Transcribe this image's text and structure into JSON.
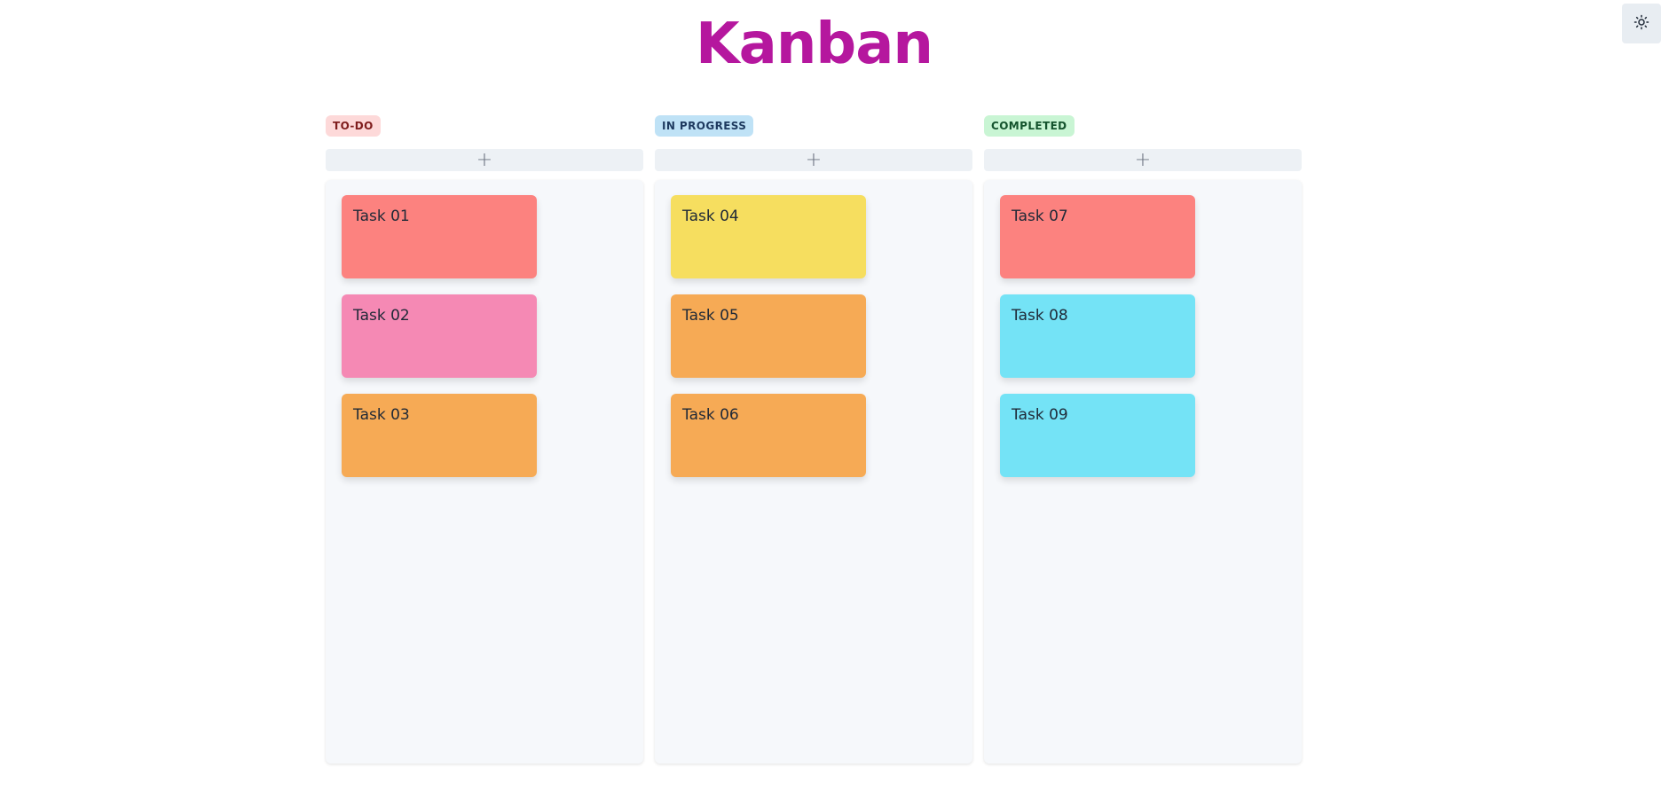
{
  "app": {
    "title": "Kanban",
    "title_color": "#b5179e"
  },
  "theme_toggle": {
    "icon": "sun-icon"
  },
  "columns": [
    {
      "label": "TO-DO",
      "badge_bg": "#fdd9d9",
      "badge_color": "#7f1d1d",
      "add_label": "+",
      "tasks": [
        {
          "title": "Task 01",
          "color": "#fc827f"
        },
        {
          "title": "Task 02",
          "color": "#f589b4"
        },
        {
          "title": "Task 03",
          "color": "#f6aa55"
        }
      ]
    },
    {
      "label": "IN PROGRESS",
      "badge_bg": "#bfe2f6",
      "badge_color": "#1e3a5f",
      "add_label": "+",
      "tasks": [
        {
          "title": "Task 04",
          "color": "#f6de5f"
        },
        {
          "title": "Task 05",
          "color": "#f6aa55"
        },
        {
          "title": "Task 06",
          "color": "#f6aa55"
        }
      ]
    },
    {
      "label": "COMPLETED",
      "badge_bg": "#c9f5d4",
      "badge_color": "#14532d",
      "add_label": "+",
      "tasks": [
        {
          "title": "Task 07",
          "color": "#fc827f"
        },
        {
          "title": "Task 08",
          "color": "#74e3f6"
        },
        {
          "title": "Task 09",
          "color": "#74e3f6"
        }
      ]
    }
  ]
}
